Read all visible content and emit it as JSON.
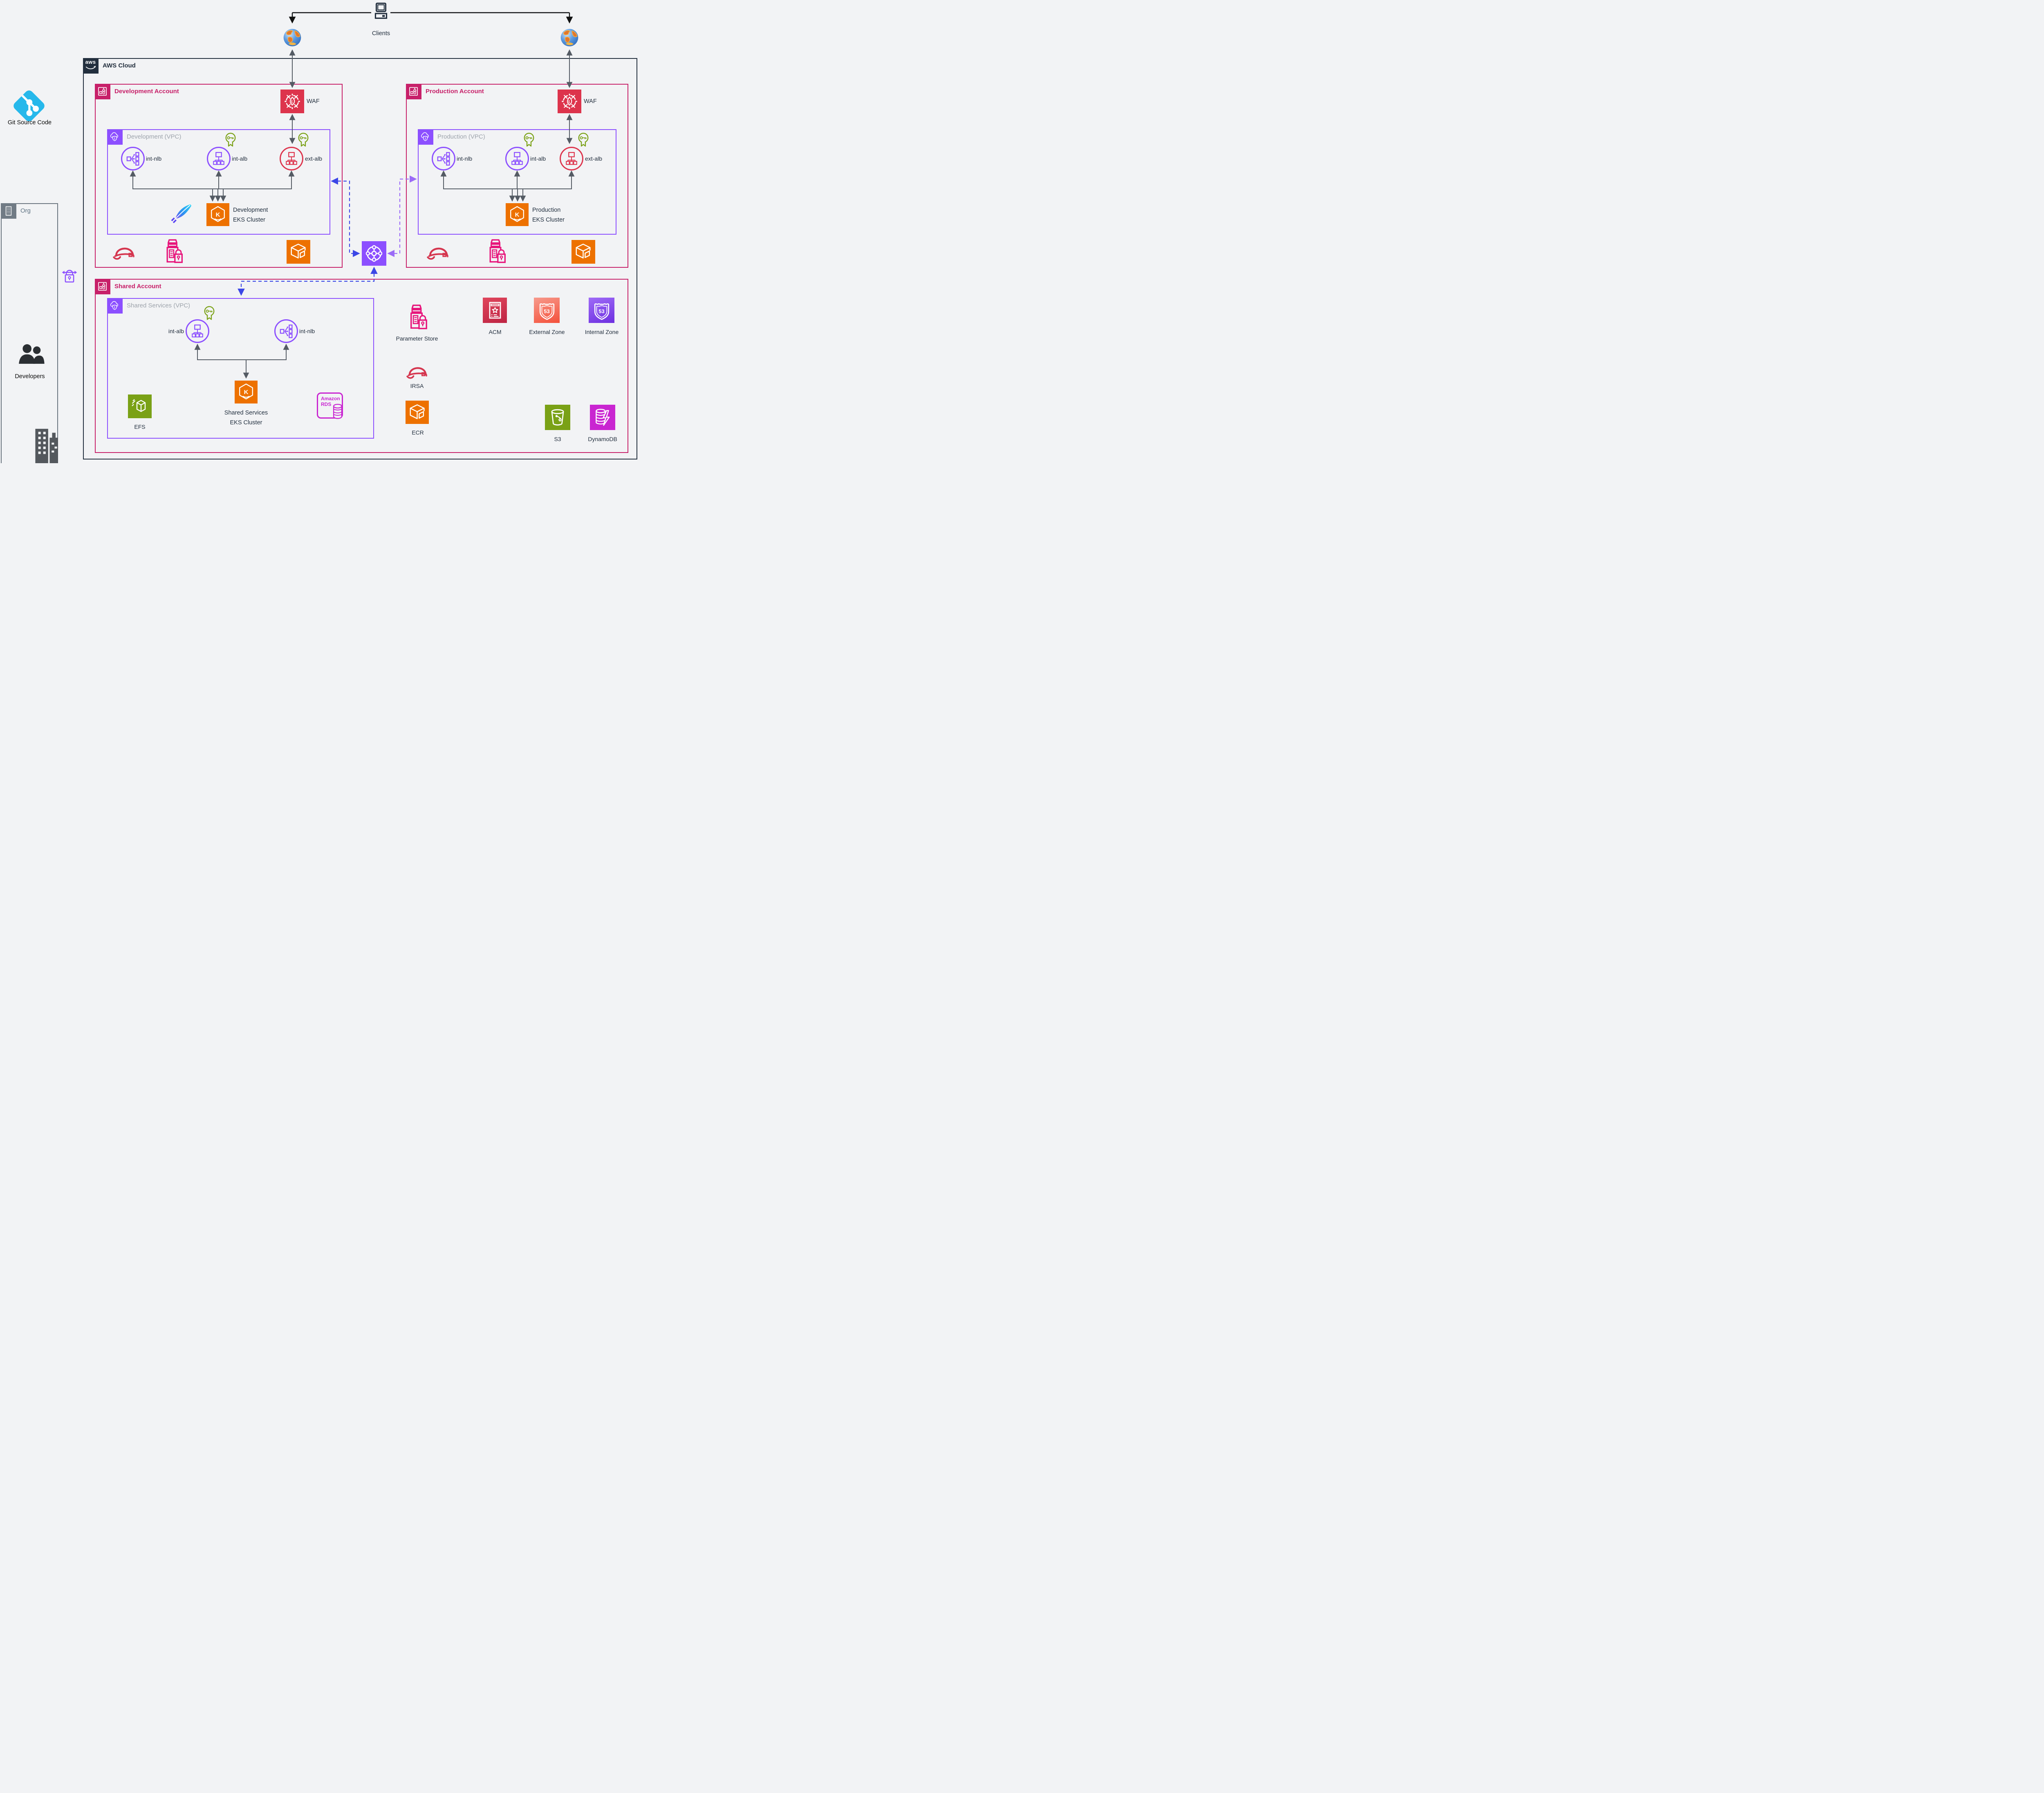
{
  "page": {
    "clients": "Clients",
    "aws_cloud": "AWS Cloud",
    "git": "Git Source Code"
  },
  "org": {
    "label": "Org",
    "developers": "Developers"
  },
  "dev": {
    "account": "Development Account",
    "waf": "WAF",
    "vpc": "Development (VPC)",
    "int_nlb": "int-nlb",
    "int_alb": "int-alb",
    "ext_alb": "ext-alb",
    "eks_line1": "Development",
    "eks_line2": "EKS Cluster"
  },
  "prod": {
    "account": "Production Account",
    "waf": "WAF",
    "vpc": "Production (VPC)",
    "int_nlb": "int-nlb",
    "int_alb": "int-alb",
    "ext_alb": "ext-alb",
    "eks_line1": "Production",
    "eks_line2": "EKS Cluster"
  },
  "shared": {
    "account": "Shared Account",
    "vpc": "Shared Services (VPC)",
    "int_alb": "int-alb",
    "int_nlb": "int-nlb",
    "eks_line1": "Shared Services",
    "eks_line2": "EKS Cluster",
    "efs": "EFS",
    "parameter_store": "Parameter Store",
    "acm": "ACM",
    "external_zone": "External Zone",
    "internal_zone": "Internal Zone",
    "irsa": "IRSA",
    "ecr": "ECR",
    "s3": "S3",
    "dynamodb": "DynamoDB"
  },
  "icons": {
    "aws_logo": "aws",
    "eks_letter": "K",
    "route53_badge": "53",
    "rds_line1": "Amazon",
    "rds_line2": "RDS"
  },
  "colors": {
    "account_pink": "#C72069",
    "vpc_purple": "#8C4FFF",
    "waf_red": "#DD344C",
    "eks_orange": "#ED7100",
    "green": "#7AA116",
    "magenta": "#C925D1",
    "param_pink": "#E7157B",
    "navy": "#232F3E",
    "dash_blue": "#3C47E6",
    "arrow_gray": "#545B64",
    "git_cyan": "#26B8EB"
  }
}
